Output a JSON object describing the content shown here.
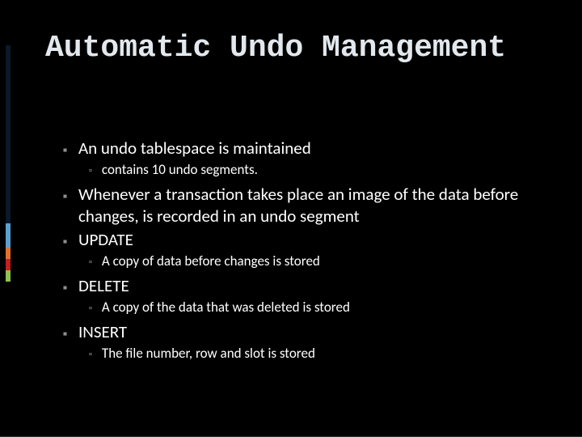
{
  "title": "Automatic Undo Management",
  "bullets": [
    {
      "text": "An undo tablespace is maintained",
      "sub": [
        {
          "text": "contains 10 undo segments."
        }
      ]
    },
    {
      "text": "Whenever a transaction takes place  an image of the data before changes, is recorded in an undo segment",
      "sub": []
    },
    {
      "text": " UPDATE",
      "sub": [
        {
          "text": " A copy of data  before changes is stored"
        }
      ]
    },
    {
      "text": " DELETE",
      "sub": [
        {
          "text": " A copy of the data that was deleted is stored"
        }
      ]
    },
    {
      "text": "  INSERT",
      "sub": [
        {
          "text": "  The file number, row and slot is  stored"
        }
      ]
    }
  ],
  "accent_colors": [
    "#0a1a2a",
    "#5aa0d0",
    "#e07030",
    "#c02020",
    "#90c050"
  ],
  "accent_heights": [
    220,
    30,
    14,
    14,
    14
  ]
}
